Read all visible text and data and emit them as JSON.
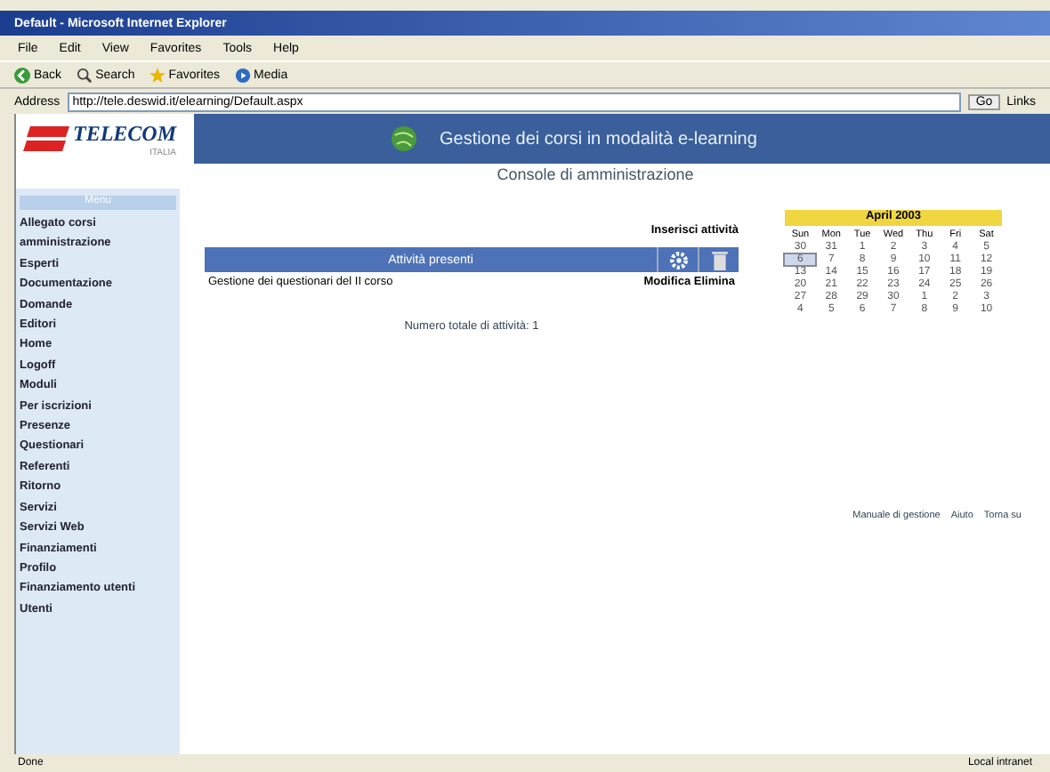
{
  "window": {
    "title": "Default - Microsoft Internet Explorer"
  },
  "menu_bar": [
    "File",
    "Edit",
    "View",
    "Favorites",
    "Tools",
    "Help"
  ],
  "toolbar": [
    {
      "label": "Back",
      "kind": "back"
    },
    {
      "label": "Search",
      "kind": "search"
    },
    {
      "label": "Favorites",
      "kind": "star"
    },
    {
      "label": "Media",
      "kind": "media"
    }
  ],
  "address_bar": {
    "label": "Address",
    "value": "http://tele.deswid.it/elearning/Default.aspx",
    "go": "Go",
    "links": "Links"
  },
  "header": {
    "logo": "TELECOM",
    "logo_sub": "ITALIA",
    "title": "Gestione dei corsi in modalità e-learning",
    "subtitle": "Console di amministrazione"
  },
  "sidebar": {
    "heading": "Menu",
    "items": [
      {
        "label": "Allegato corsi amministrazione"
      },
      {
        "label": "Esperti"
      },
      {
        "label": "Documentazione"
      },
      {
        "label": "Domande"
      },
      {
        "label": "Editori"
      },
      {
        "label": "Home"
      },
      {
        "label": "Logoff"
      },
      {
        "label": "Moduli"
      },
      {
        "label": "Per iscrizioni"
      },
      {
        "label": "Presenze"
      },
      {
        "label": "Questionari"
      },
      {
        "label": "Referenti"
      },
      {
        "label": "Ritorno"
      },
      {
        "label": "Servizi"
      },
      {
        "label": "Servizi Web"
      },
      {
        "label": "Finanziamenti"
      },
      {
        "label": "Profilo"
      },
      {
        "label": "Finanziamento utenti"
      },
      {
        "label": "Utenti"
      }
    ]
  },
  "activities": {
    "insert_link": "Inserisci attività",
    "column": "Attività presenti",
    "rows": [
      {
        "name": "Gestione dei questionari del II corso",
        "action": "Modifica Elimina"
      }
    ],
    "total": "Numero totale di attività: 1"
  },
  "calendar": {
    "month": "April 2003",
    "weekdays": [
      "Sun",
      "Mon",
      "Tue",
      "Wed",
      "Thu",
      "Fri",
      "Sat"
    ],
    "days": [
      {
        "label": "30",
        "selected": false
      },
      {
        "label": "31",
        "selected": false
      },
      {
        "label": "1",
        "selected": false
      },
      {
        "label": "2",
        "selected": false
      },
      {
        "label": "3",
        "selected": false
      },
      {
        "label": "4",
        "selected": false
      },
      {
        "label": "5",
        "selected": false
      },
      {
        "label": "6",
        "selected": true
      },
      {
        "label": "7",
        "selected": false
      },
      {
        "label": "8",
        "selected": false
      },
      {
        "label": "9",
        "selected": false
      },
      {
        "label": "10",
        "selected": false
      },
      {
        "label": "11",
        "selected": false
      },
      {
        "label": "12",
        "selected": false
      },
      {
        "label": "13",
        "selected": false
      },
      {
        "label": "14",
        "selected": false
      },
      {
        "label": "15",
        "selected": false
      },
      {
        "label": "16",
        "selected": false
      },
      {
        "label": "17",
        "selected": false
      },
      {
        "label": "18",
        "selected": false
      },
      {
        "label": "19",
        "selected": false
      },
      {
        "label": "20",
        "selected": false
      },
      {
        "label": "21",
        "selected": false
      },
      {
        "label": "22",
        "selected": false
      },
      {
        "label": "23",
        "selected": false
      },
      {
        "label": "24",
        "selected": false
      },
      {
        "label": "25",
        "selected": false
      },
      {
        "label": "26",
        "selected": false
      },
      {
        "label": "27",
        "selected": false
      },
      {
        "label": "28",
        "selected": false
      },
      {
        "label": "29",
        "selected": false
      },
      {
        "label": "30",
        "selected": false
      },
      {
        "label": "1",
        "selected": false
      },
      {
        "label": "2",
        "selected": false
      },
      {
        "label": "3",
        "selected": false
      },
      {
        "label": "4",
        "selected": false
      },
      {
        "label": "5",
        "selected": false
      },
      {
        "label": "6",
        "selected": false
      },
      {
        "label": "7",
        "selected": false
      },
      {
        "label": "8",
        "selected": false
      },
      {
        "label": "9",
        "selected": false
      },
      {
        "label": "10",
        "selected": false
      }
    ]
  },
  "footer_links": [
    "Manuale di gestione",
    "Aiuto",
    "Torna su"
  ],
  "status_bar": {
    "text": "Done",
    "zone": "Local intranet"
  }
}
